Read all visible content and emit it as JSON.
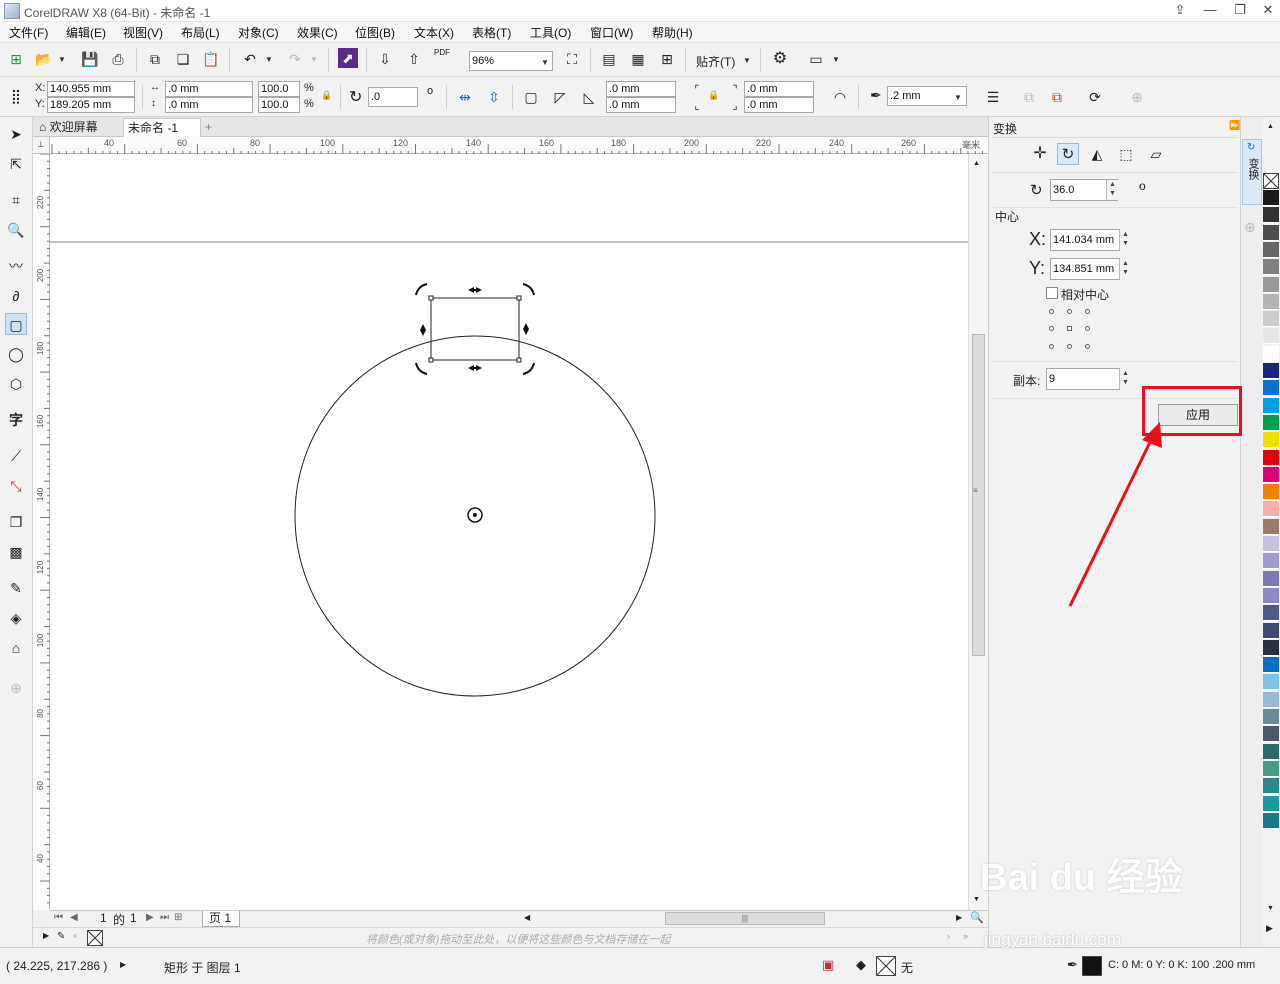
{
  "window": {
    "title": "CorelDRAW X8 (64-Bit) - 未命名 -1"
  },
  "menu": [
    "文件(F)",
    "编辑(E)",
    "视图(V)",
    "布局(L)",
    "对象(C)",
    "效果(C)",
    "位图(B)",
    "文本(X)",
    "表格(T)",
    "工具(O)",
    "窗口(W)",
    "帮助(H)"
  ],
  "toolbar": {
    "zoom": "96%",
    "snap_label": "贴齐(T)",
    "pdf_label": "PDF"
  },
  "property_bar": {
    "x": "140.955 mm",
    "y": "189.205 mm",
    "x_label": "X:",
    "y_label": "Y:",
    "width": ".0 mm",
    "height": ".0 mm",
    "scale_x": "100.0",
    "scale_y": "100.0",
    "percent": "%",
    "rotation": ".0",
    "degree": "o",
    "corner_1": ".0 mm",
    "corner_2": ".0 mm",
    "corner_3": ".0 mm",
    "corner_4": ".0 mm",
    "outline_width": ".2 mm"
  },
  "doc_tabs": [
    {
      "label": "欢迎屏幕"
    },
    {
      "label": "未命名 -1"
    }
  ],
  "ruler": {
    "h_ticks": [
      "40",
      "60",
      "80",
      "100",
      "120",
      "140",
      "160",
      "180",
      "200",
      "220",
      "240",
      "260"
    ],
    "h_unit": "毫米",
    "v_ticks": [
      "220",
      "200",
      "180",
      "160",
      "140",
      "120",
      "100",
      "80",
      "60",
      "40"
    ]
  },
  "page_nav": {
    "current": "1",
    "of": "的",
    "total": "1",
    "page_tab": "页 1"
  },
  "palette_hint": "将颜色(或对象)拖动至此处，以便将这些颜色与文档存储在一起",
  "status": {
    "coords": "( 24.225, 217.286 )",
    "object_info": "矩形 于 图层 1",
    "fill_none": "无",
    "outline_info": "C: 0 M: 0 Y: 0 K: 100  .200 mm"
  },
  "docker": {
    "title": "变换",
    "rotation_value": "36.0",
    "degree": "o",
    "center_label": "中心",
    "x_label": "X:",
    "y_label": "Y:",
    "x_value": "141.034 mm",
    "y_value": "134.851 mm",
    "relative_center_label": "相对中心",
    "copies_label": "副本:",
    "copies_value": "9",
    "apply_label": "应用"
  },
  "side_tab_label": "变换",
  "watermark": {
    "brand": "Bai du 经验",
    "url": "jingyan.baidu.com"
  },
  "palette_colors": [
    "#1a1a1a",
    "#333333",
    "#4d4d4d",
    "#666666",
    "#808080",
    "#999999",
    "#b3b3b3",
    "#cccccc",
    "#e6e6e6",
    "#ffffff",
    "#1a237e",
    "#0d6fd0",
    "#00a0e0",
    "#00a050",
    "#f0e000",
    "#e00010",
    "#e0007a",
    "#f08000",
    "#f2b0b0",
    "#9a7a6a",
    "#c8c0e0",
    "#a09ad0",
    "#7a7ab8",
    "#8a8ac8",
    "#505a8a",
    "#404a70",
    "#2a3040",
    "#0070c0",
    "#80c0e8",
    "#9ab8d0",
    "#6a8a9a",
    "#4a5a6a",
    "#2a6a6a",
    "#4a9a8a",
    "#2a8a8a",
    "#1a9a9a",
    "#1a7a8a"
  ]
}
